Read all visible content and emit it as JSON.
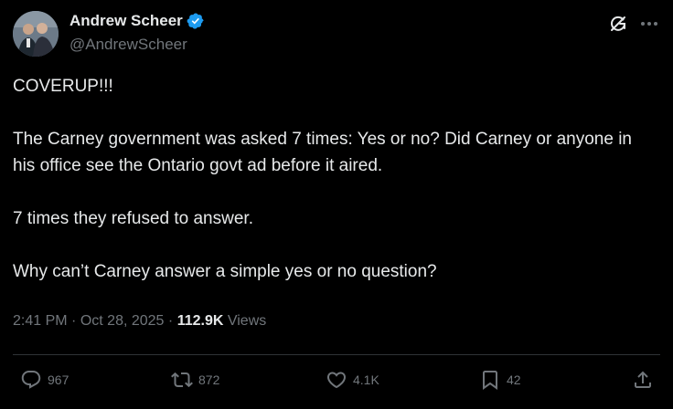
{
  "author": {
    "display_name": "Andrew Scheer",
    "handle": "@AndrewScheer"
  },
  "post": {
    "lines": [
      "COVERUP!!!",
      "The Carney government was asked 7 times: Yes or no? Did Carney or anyone in his office see the Ontario govt ad before it aired.",
      "7 times they refused to answer.",
      "Why can’t Carney answer a simple yes or no question?"
    ]
  },
  "meta": {
    "time": "2:41 PM",
    "separator": "·",
    "date": "Oct 28, 2025",
    "views_count": "112.9K",
    "views_label": "Views"
  },
  "actions": {
    "replies": "967",
    "reposts": "872",
    "likes": "4.1K",
    "bookmarks": "42"
  },
  "colors": {
    "background": "#000000",
    "text": "#e7e9ea",
    "muted": "#71767b",
    "verified": "#1d9bf0",
    "divider": "#2f3336"
  },
  "icons": [
    "verified-icon",
    "grok-icon",
    "more-icon",
    "reply-icon",
    "repost-icon",
    "like-icon",
    "bookmark-icon",
    "share-icon"
  ]
}
